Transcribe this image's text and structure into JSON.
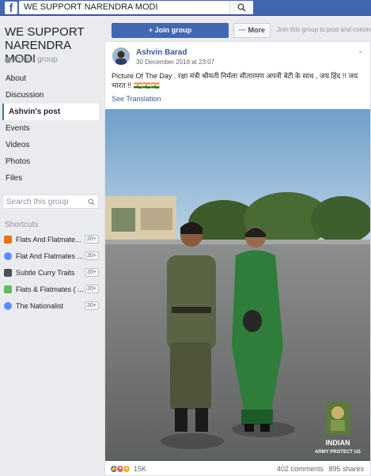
{
  "topbar": {
    "logo_letter": "f",
    "search_value": "WE SUPPORT NARENDRA MODI"
  },
  "sidebar": {
    "group_title": "WE SUPPORT NARENDRA MODI",
    "privacy": "Public group",
    "nav": [
      {
        "label": "About"
      },
      {
        "label": "Discussion"
      },
      {
        "label": "Ashvin's post"
      },
      {
        "label": "Events"
      },
      {
        "label": "Videos"
      },
      {
        "label": "Photos"
      },
      {
        "label": "Files"
      }
    ],
    "search_placeholder": "Search this group",
    "shortcuts_header": "Shortcuts",
    "shortcuts": [
      {
        "label": "Flats And Flatmate...",
        "badge": "20+",
        "color": "#e9710f"
      },
      {
        "label": "Flat And Flatmates ...",
        "badge": "20+",
        "color": "#5890ff"
      },
      {
        "label": "Subtle Curry Traits",
        "badge": "20+",
        "color": "#4b4f56"
      },
      {
        "label": "Flats & Flatmates ( ...",
        "badge": "20+",
        "color": "#5ebd5e"
      },
      {
        "label": "The Nationalist",
        "badge": "20+",
        "color": "#5890ff"
      }
    ]
  },
  "actions": {
    "join_label": "+ Join group",
    "more_label": "··· More",
    "join_prompt": "Join this group to post and comme"
  },
  "post": {
    "author": "Ashvin Barad",
    "date": "30 December 2018 at 23:07",
    "text": "Picture Of The Day . रक्षा मंत्री श्रीमती निर्मला सीतारमण अपनी बेटी के साथ , जय हिंद !! जय भारत !! 🇮🇳🇮🇳🇮🇳",
    "see_translation": "See Translation",
    "photo_caption_line1": "INDIAN",
    "photo_caption_line2": "ARMY PROTECT US",
    "reaction_count": "15K",
    "comments": "402 comments",
    "shares": "895 shares"
  },
  "colors": {
    "brand": "#4267b2",
    "link": "#385898"
  }
}
